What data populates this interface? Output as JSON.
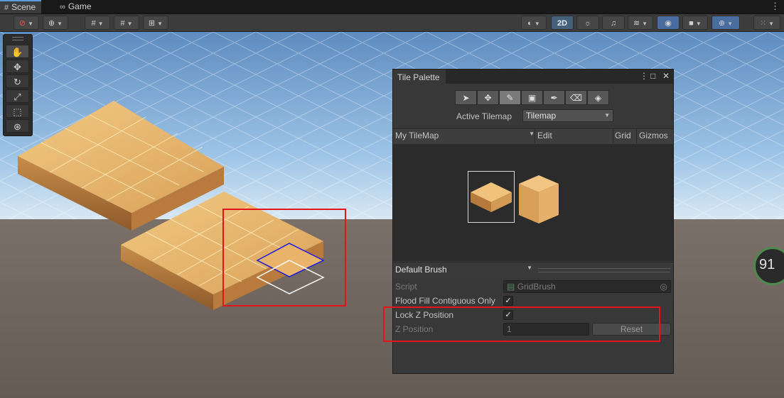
{
  "tabs": [
    {
      "label": "Scene",
      "icon": "grid-icon"
    },
    {
      "label": "Game",
      "icon": "gamepad-icon"
    }
  ],
  "toolbar": {
    "mode_2d_label": "2D"
  },
  "scene_tools": [
    "hand-tool",
    "move-tool",
    "rotate-tool",
    "scale-tool",
    "rect-tool",
    "transform-tool"
  ],
  "tile_palette": {
    "title": "Tile Palette",
    "active_tilemap_label": "Active Tilemap",
    "active_tilemap_value": "Tilemap",
    "palette_name": "My TileMap",
    "edit_label": "Edit",
    "grid_label": "Grid",
    "gizmos_label": "Gizmos",
    "brush_name": "Default Brush",
    "properties": {
      "script_label": "Script",
      "script_value": "GridBrush",
      "flood_fill_label": "Flood Fill Contiguous Only",
      "flood_fill_checked": true,
      "lock_z_label": "Lock Z Position",
      "lock_z_checked": true,
      "z_position_label": "Z Position",
      "z_position_value": "1",
      "reset_label": "Reset"
    }
  },
  "fps": {
    "value": "91"
  },
  "colors": {
    "highlight": "#e4141b",
    "selection_blue": "#1a1ae0",
    "sky": "#8fb8df",
    "ground": "#6b6158"
  }
}
